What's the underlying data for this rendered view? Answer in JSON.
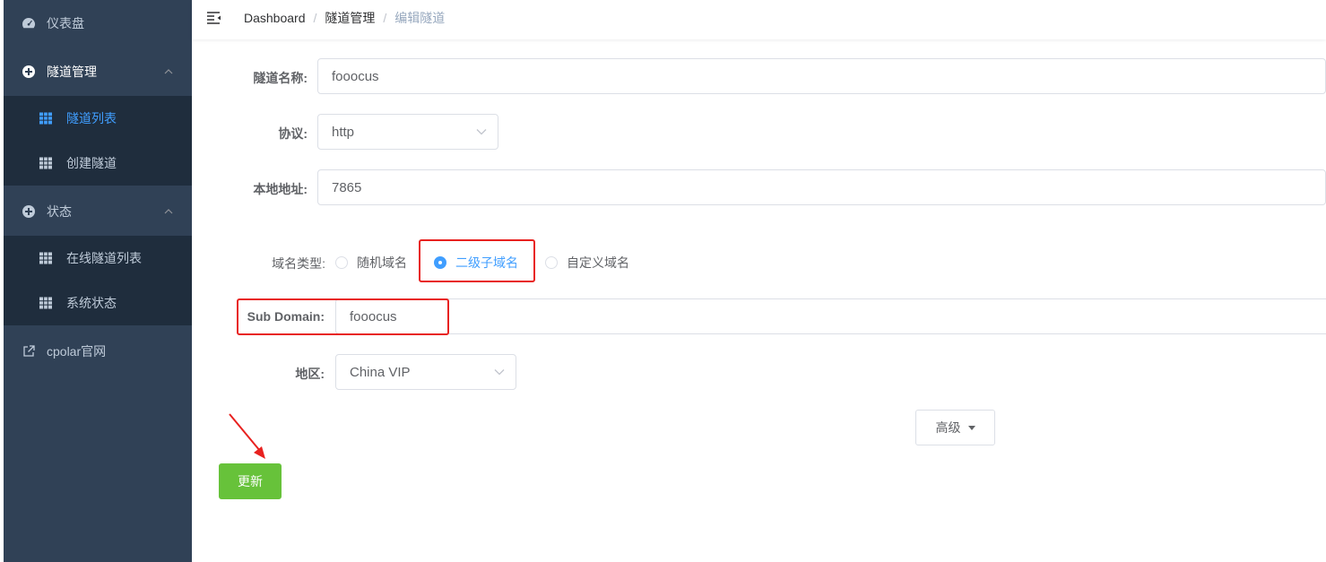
{
  "sidebar": {
    "dashboard": {
      "label": "仪表盘",
      "icon": "dashboard-icon"
    },
    "tunnel_mgmt": {
      "label": "隧道管理",
      "icon": "circle-plus-icon"
    },
    "tunnel_list": {
      "label": "隧道列表",
      "icon": "table-icon"
    },
    "create_tunnel": {
      "label": "创建隧道",
      "icon": "table-icon"
    },
    "status": {
      "label": "状态",
      "icon": "circle-plus-icon"
    },
    "online_tunnels": {
      "label": "在线隧道列表",
      "icon": "table-icon"
    },
    "system_status": {
      "label": "系统状态",
      "icon": "table-icon"
    },
    "cpolar_site": {
      "label": "cpolar官网",
      "icon": "external-link-icon"
    }
  },
  "breadcrumb": [
    "Dashboard",
    "隧道管理",
    "编辑隧道"
  ],
  "form": {
    "tunnel_name_label": "隧道名称:",
    "tunnel_name_value": "fooocus",
    "protocol_label": "协议:",
    "protocol_value": "http",
    "local_addr_label": "本地地址:",
    "local_addr_value": "7865",
    "domain_type_label": "域名类型:",
    "domain_options": [
      "随机域名",
      "二级子域名",
      "自定义域名"
    ],
    "domain_selected": "二级子域名",
    "subdomain_label": "Sub Domain:",
    "subdomain_value": "fooocus",
    "region_label": "地区:",
    "region_value": "China VIP"
  },
  "buttons": {
    "advanced": "高级",
    "update": "更新"
  },
  "colors": {
    "sidebar_bg": "#304156",
    "submenu_bg": "#1f2d3d",
    "active": "#409eff",
    "success": "#67c23a",
    "highlight": "#e8211f"
  }
}
